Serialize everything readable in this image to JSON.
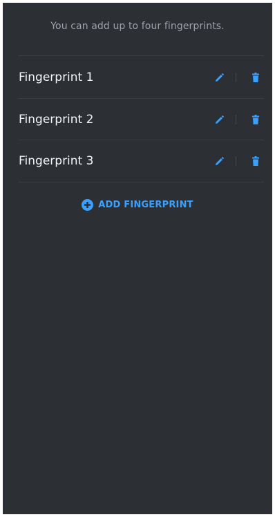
{
  "info_text": "You can add up to four fingerprints.",
  "fingerprints": [
    {
      "label": "Fingerprint 1",
      "edit_icon": "pencil-icon",
      "delete_icon": "trash-icon"
    },
    {
      "label": "Fingerprint 2",
      "edit_icon": "pencil-icon",
      "delete_icon": "trash-icon"
    },
    {
      "label": "Fingerprint 3",
      "edit_icon": "pencil-icon",
      "delete_icon": "trash-icon"
    }
  ],
  "add_button": {
    "label": "ADD FINGERPRINT",
    "icon": "plus-circle-icon"
  },
  "colors": {
    "background": "#2c2f33",
    "accent": "#3aa0ff",
    "text": "#f4f5f6",
    "secondary_text": "#9ea2a8"
  }
}
